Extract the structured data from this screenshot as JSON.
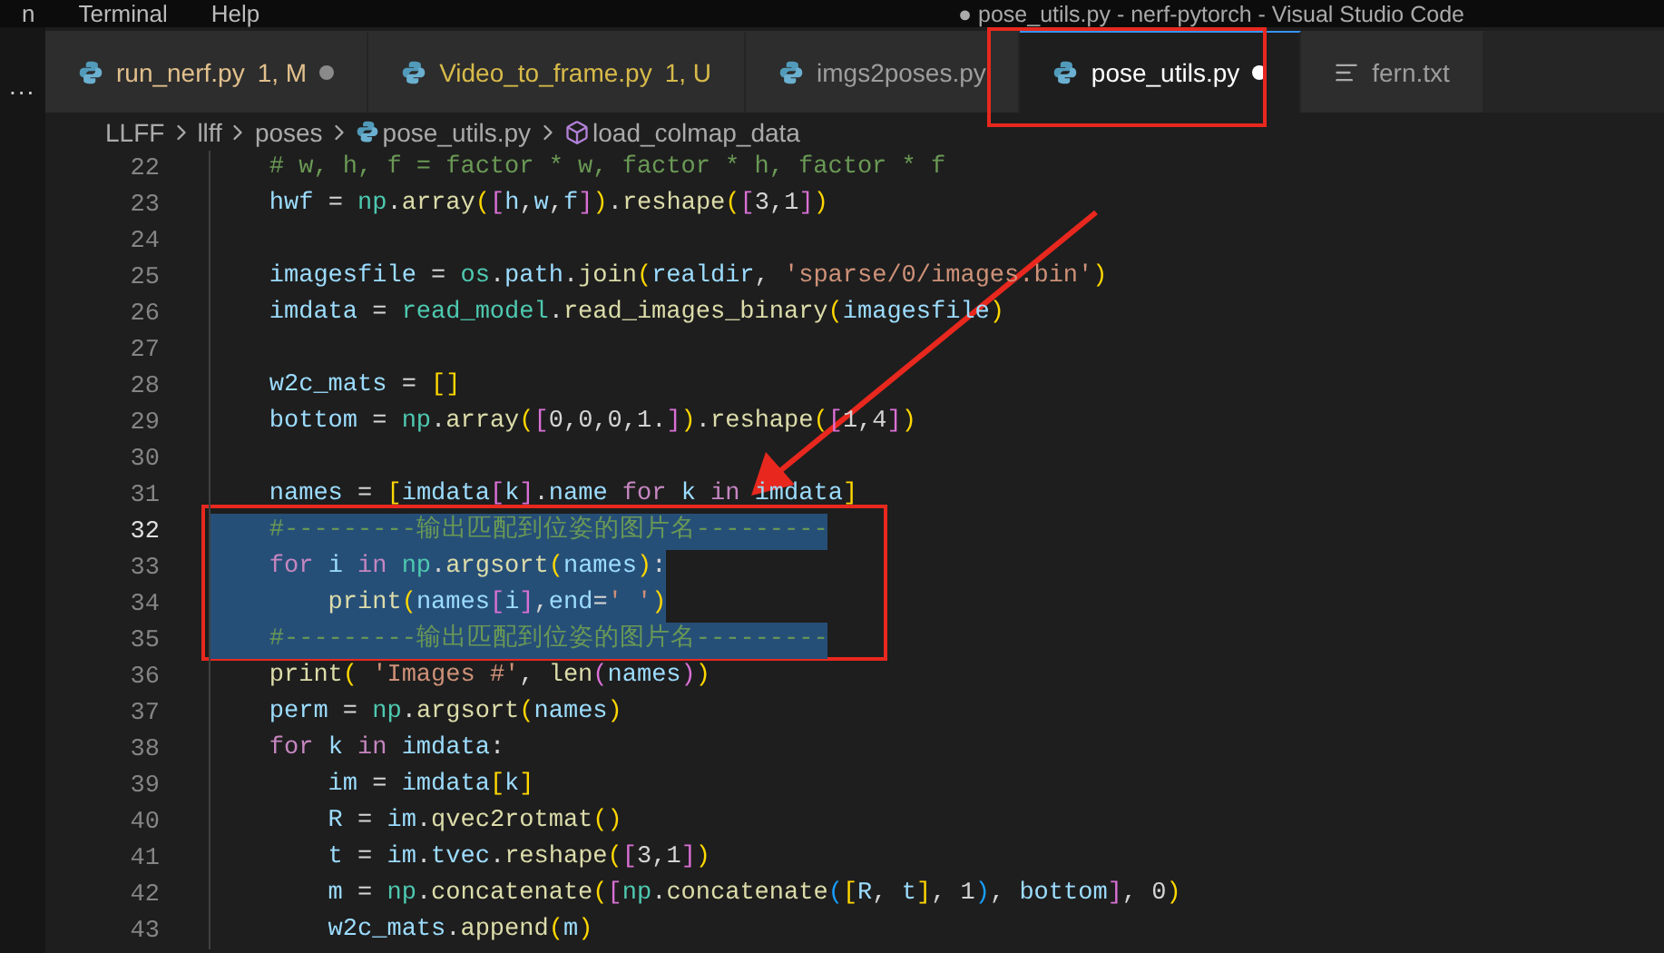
{
  "menu": [
    "n",
    "Terminal",
    "Help"
  ],
  "window": {
    "title": "● pose_utils.py - nerf-pytorch - Visual Studio Code"
  },
  "activity_bar": {
    "more": "..."
  },
  "tabs": [
    {
      "label": "run_nerf.py",
      "status": "1, M",
      "kind": "python",
      "color": "#e2c08d",
      "modified": true,
      "selected": false
    },
    {
      "label": "Video_to_frame.py",
      "status": "1, U",
      "kind": "python",
      "color": "#d7ba4a",
      "modified": false,
      "selected": false
    },
    {
      "label": "imgs2poses.py",
      "kind": "python",
      "modified": false,
      "selected": false
    },
    {
      "label": "pose_utils.py",
      "kind": "python",
      "modified": true,
      "selected": true
    },
    {
      "label": "fern.txt",
      "kind": "text",
      "modified": false,
      "selected": false
    }
  ],
  "breadcrumbs": [
    {
      "label": "LLFF",
      "kind": "folder"
    },
    {
      "label": "llff",
      "kind": "folder"
    },
    {
      "label": "poses",
      "kind": "folder"
    },
    {
      "label": "pose_utils.py",
      "kind": "python"
    },
    {
      "label": "load_colmap_data",
      "kind": "method"
    }
  ],
  "code": [
    {
      "number": "22",
      "selected": false,
      "current": false,
      "tokens": [
        {
          "kind": "comment",
          "text": "    # w, h, f = factor * w, factor * h, factor * f"
        }
      ]
    },
    {
      "number": "23",
      "selected": false,
      "current": false,
      "tokens": [
        {
          "kind": "var",
          "text": "    hwf"
        },
        {
          "kind": "plain",
          "text": " = "
        },
        {
          "kind": "module",
          "text": "np"
        },
        {
          "kind": "plain",
          "text": "."
        },
        {
          "kind": "func",
          "text": "array"
        },
        {
          "kind": "b1",
          "text": "("
        },
        {
          "kind": "b2",
          "text": "["
        },
        {
          "kind": "var",
          "text": "h"
        },
        {
          "kind": "plain",
          "text": ","
        },
        {
          "kind": "var",
          "text": "w"
        },
        {
          "kind": "plain",
          "text": ","
        },
        {
          "kind": "var",
          "text": "f"
        },
        {
          "kind": "b2",
          "text": "]"
        },
        {
          "kind": "b1",
          "text": ")"
        },
        {
          "kind": "plain",
          "text": "."
        },
        {
          "kind": "func",
          "text": "reshape"
        },
        {
          "kind": "b1",
          "text": "("
        },
        {
          "kind": "b2",
          "text": "["
        },
        {
          "kind": "plain",
          "text": "3,1"
        },
        {
          "kind": "b2",
          "text": "]"
        },
        {
          "kind": "b1",
          "text": ")"
        }
      ]
    },
    {
      "number": "24",
      "selected": false,
      "current": false
    },
    {
      "number": "25",
      "selected": false,
      "current": false,
      "tokens": [
        {
          "kind": "var",
          "text": "    imagesfile"
        },
        {
          "kind": "plain",
          "text": " = "
        },
        {
          "kind": "module",
          "text": "os"
        },
        {
          "kind": "plain",
          "text": "."
        },
        {
          "kind": "var",
          "text": "path"
        },
        {
          "kind": "plain",
          "text": "."
        },
        {
          "kind": "func",
          "text": "join"
        },
        {
          "kind": "b1",
          "text": "("
        },
        {
          "kind": "var",
          "text": "realdir"
        },
        {
          "kind": "plain",
          "text": ", "
        },
        {
          "kind": "string",
          "text": "'sparse/0/images.bin'"
        },
        {
          "kind": "b1",
          "text": ")"
        }
      ]
    },
    {
      "number": "26",
      "selected": false,
      "current": false,
      "tokens": [
        {
          "kind": "var",
          "text": "    imdata"
        },
        {
          "kind": "plain",
          "text": " = "
        },
        {
          "kind": "module",
          "text": "read_model"
        },
        {
          "kind": "plain",
          "text": "."
        },
        {
          "kind": "func",
          "text": "read_images_binary"
        },
        {
          "kind": "b1",
          "text": "("
        },
        {
          "kind": "var",
          "text": "imagesfile"
        },
        {
          "kind": "b1",
          "text": ")"
        }
      ]
    },
    {
      "number": "27",
      "selected": false,
      "current": false
    },
    {
      "number": "28",
      "selected": false,
      "current": false,
      "tokens": [
        {
          "kind": "var",
          "text": "    w2c_mats"
        },
        {
          "kind": "plain",
          "text": " = "
        },
        {
          "kind": "b1",
          "text": "[]"
        }
      ]
    },
    {
      "number": "29",
      "selected": false,
      "current": false,
      "tokens": [
        {
          "kind": "var",
          "text": "    bottom"
        },
        {
          "kind": "plain",
          "text": " = "
        },
        {
          "kind": "module",
          "text": "np"
        },
        {
          "kind": "plain",
          "text": "."
        },
        {
          "kind": "func",
          "text": "array"
        },
        {
          "kind": "b1",
          "text": "("
        },
        {
          "kind": "b2",
          "text": "["
        },
        {
          "kind": "plain",
          "text": "0,0,0,1."
        },
        {
          "kind": "b2",
          "text": "]"
        },
        {
          "kind": "b1",
          "text": ")"
        },
        {
          "kind": "plain",
          "text": "."
        },
        {
          "kind": "func",
          "text": "reshape"
        },
        {
          "kind": "b1",
          "text": "("
        },
        {
          "kind": "b2",
          "text": "["
        },
        {
          "kind": "plain",
          "text": "1,4"
        },
        {
          "kind": "b2",
          "text": "]"
        },
        {
          "kind": "b1",
          "text": ")"
        }
      ]
    },
    {
      "number": "30",
      "selected": false,
      "current": false
    },
    {
      "number": "31",
      "selected": false,
      "current": false,
      "tokens": [
        {
          "kind": "var",
          "text": "    names"
        },
        {
          "kind": "plain",
          "text": " = "
        },
        {
          "kind": "b1",
          "text": "["
        },
        {
          "kind": "var",
          "text": "imdata"
        },
        {
          "kind": "b2",
          "text": "["
        },
        {
          "kind": "var",
          "text": "k"
        },
        {
          "kind": "b2",
          "text": "]"
        },
        {
          "kind": "plain",
          "text": "."
        },
        {
          "kind": "var",
          "text": "name"
        },
        {
          "kind": "keyword",
          "text": " for "
        },
        {
          "kind": "var",
          "text": "k"
        },
        {
          "kind": "keyword",
          "text": " in "
        },
        {
          "kind": "var",
          "text": "imdata"
        },
        {
          "kind": "b1",
          "text": "]"
        }
      ]
    },
    {
      "number": "32",
      "selected": true,
      "current": true,
      "tokens": [
        {
          "kind": "comment",
          "text": "    #---------输出匹配到位姿的图片名---------"
        }
      ]
    },
    {
      "number": "33",
      "selected": true,
      "current": false,
      "tokens": [
        {
          "kind": "keyword",
          "text": "    for "
        },
        {
          "kind": "var",
          "text": "i"
        },
        {
          "kind": "keyword",
          "text": " in "
        },
        {
          "kind": "module",
          "text": "np"
        },
        {
          "kind": "plain",
          "text": "."
        },
        {
          "kind": "func",
          "text": "argsort"
        },
        {
          "kind": "b1",
          "text": "("
        },
        {
          "kind": "var",
          "text": "names"
        },
        {
          "kind": "b1",
          "text": ")"
        },
        {
          "kind": "plain",
          "text": ":"
        }
      ]
    },
    {
      "number": "34",
      "selected": true,
      "current": false,
      "tokens": [
        {
          "kind": "func",
          "text": "        print"
        },
        {
          "kind": "b1",
          "text": "("
        },
        {
          "kind": "var",
          "text": "names"
        },
        {
          "kind": "b2",
          "text": "["
        },
        {
          "kind": "var",
          "text": "i"
        },
        {
          "kind": "b2",
          "text": "]"
        },
        {
          "kind": "plain",
          "text": ","
        },
        {
          "kind": "var",
          "text": "end"
        },
        {
          "kind": "plain",
          "text": "="
        },
        {
          "kind": "string",
          "text": "' '"
        },
        {
          "kind": "b1",
          "text": ")"
        }
      ]
    },
    {
      "number": "35",
      "selected": true,
      "current": false,
      "tokens": [
        {
          "kind": "comment",
          "text": "    #---------输出匹配到位姿的图片名---------"
        }
      ]
    },
    {
      "number": "36",
      "selected": false,
      "current": false,
      "tokens": [
        {
          "kind": "func",
          "text": "    print"
        },
        {
          "kind": "b1",
          "text": "("
        },
        {
          "kind": "string",
          "text": " 'Images #'"
        },
        {
          "kind": "plain",
          "text": ", "
        },
        {
          "kind": "func",
          "text": "len"
        },
        {
          "kind": "b2",
          "text": "("
        },
        {
          "kind": "var",
          "text": "names"
        },
        {
          "kind": "b2",
          "text": ")"
        },
        {
          "kind": "b1",
          "text": ")"
        }
      ]
    },
    {
      "number": "37",
      "selected": false,
      "current": false,
      "tokens": [
        {
          "kind": "var",
          "text": "    perm"
        },
        {
          "kind": "plain",
          "text": " = "
        },
        {
          "kind": "module",
          "text": "np"
        },
        {
          "kind": "plain",
          "text": "."
        },
        {
          "kind": "func",
          "text": "argsort"
        },
        {
          "kind": "b1",
          "text": "("
        },
        {
          "kind": "var",
          "text": "names"
        },
        {
          "kind": "b1",
          "text": ")"
        }
      ]
    },
    {
      "number": "38",
      "selected": false,
      "current": false,
      "tokens": [
        {
          "kind": "keyword",
          "text": "    for "
        },
        {
          "kind": "var",
          "text": "k"
        },
        {
          "kind": "keyword",
          "text": " in "
        },
        {
          "kind": "var",
          "text": "imdata"
        },
        {
          "kind": "plain",
          "text": ":"
        }
      ]
    },
    {
      "number": "39",
      "selected": false,
      "current": false,
      "tokens": [
        {
          "kind": "var",
          "text": "        im"
        },
        {
          "kind": "plain",
          "text": " = "
        },
        {
          "kind": "var",
          "text": "imdata"
        },
        {
          "kind": "b1",
          "text": "["
        },
        {
          "kind": "var",
          "text": "k"
        },
        {
          "kind": "b1",
          "text": "]"
        }
      ]
    },
    {
      "number": "40",
      "selected": false,
      "current": false,
      "tokens": [
        {
          "kind": "var",
          "text": "        R"
        },
        {
          "kind": "plain",
          "text": " = "
        },
        {
          "kind": "var",
          "text": "im"
        },
        {
          "kind": "plain",
          "text": "."
        },
        {
          "kind": "func",
          "text": "qvec2rotmat"
        },
        {
          "kind": "b1",
          "text": "()"
        }
      ]
    },
    {
      "number": "41",
      "selected": false,
      "current": false,
      "tokens": [
        {
          "kind": "var",
          "text": "        t"
        },
        {
          "kind": "plain",
          "text": " = "
        },
        {
          "kind": "var",
          "text": "im"
        },
        {
          "kind": "plain",
          "text": "."
        },
        {
          "kind": "var",
          "text": "tvec"
        },
        {
          "kind": "plain",
          "text": "."
        },
        {
          "kind": "func",
          "text": "reshape"
        },
        {
          "kind": "b1",
          "text": "("
        },
        {
          "kind": "b2",
          "text": "["
        },
        {
          "kind": "plain",
          "text": "3,1"
        },
        {
          "kind": "b2",
          "text": "]"
        },
        {
          "kind": "b1",
          "text": ")"
        }
      ]
    },
    {
      "number": "42",
      "selected": false,
      "current": false,
      "tokens": [
        {
          "kind": "var",
          "text": "        m"
        },
        {
          "kind": "plain",
          "text": " = "
        },
        {
          "kind": "module",
          "text": "np"
        },
        {
          "kind": "plain",
          "text": "."
        },
        {
          "kind": "func",
          "text": "concatenate"
        },
        {
          "kind": "b1",
          "text": "("
        },
        {
          "kind": "b2",
          "text": "["
        },
        {
          "kind": "module",
          "text": "np"
        },
        {
          "kind": "plain",
          "text": "."
        },
        {
          "kind": "func",
          "text": "concatenate"
        },
        {
          "kind": "b3",
          "text": "("
        },
        {
          "kind": "b1",
          "text": "["
        },
        {
          "kind": "var",
          "text": "R"
        },
        {
          "kind": "plain",
          "text": ", "
        },
        {
          "kind": "var",
          "text": "t"
        },
        {
          "kind": "b1",
          "text": "]"
        },
        {
          "kind": "plain",
          "text": ", 1"
        },
        {
          "kind": "b3",
          "text": ")"
        },
        {
          "kind": "plain",
          "text": ", "
        },
        {
          "kind": "var",
          "text": "bottom"
        },
        {
          "kind": "b2",
          "text": "]"
        },
        {
          "kind": "plain",
          "text": ", 0"
        },
        {
          "kind": "b1",
          "text": ")"
        }
      ]
    },
    {
      "number": "43",
      "selected": false,
      "current": false,
      "tokens": [
        {
          "kind": "var",
          "text": "        w2c_mats"
        },
        {
          "kind": "plain",
          "text": "."
        },
        {
          "kind": "func",
          "text": "append"
        },
        {
          "kind": "b1",
          "text": "("
        },
        {
          "kind": "var",
          "text": "m"
        },
        {
          "kind": "b1",
          "text": ")"
        }
      ]
    }
  ]
}
